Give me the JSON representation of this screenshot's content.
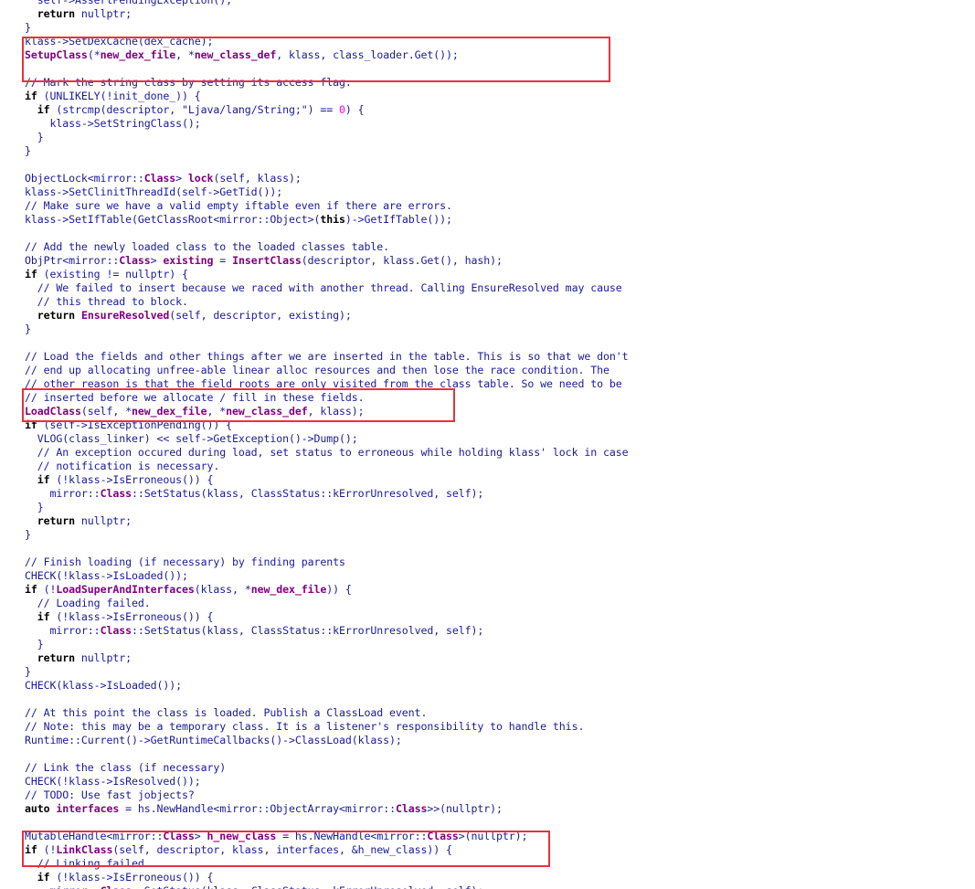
{
  "code_lines": [
    [
      {
        "t": "  self->AssertPendingException();",
        "c": "op"
      }
    ],
    [
      {
        "t": "  ",
        "c": "op"
      },
      {
        "t": "return",
        "c": "kw"
      },
      {
        "t": " nullptr;",
        "c": "op"
      }
    ],
    [
      {
        "t": "}",
        "c": "op"
      }
    ],
    [
      {
        "t": "klass->SetDexCache(dex_cache);",
        "c": "op"
      }
    ],
    [
      {
        "t": "SetupClass",
        "c": "fn"
      },
      {
        "t": "(*",
        "c": "op"
      },
      {
        "t": "new_dex_file",
        "c": "var"
      },
      {
        "t": ", *",
        "c": "op"
      },
      {
        "t": "new_class_def",
        "c": "var"
      },
      {
        "t": ", klass, class_loader.Get());",
        "c": "op"
      }
    ],
    [
      {
        "t": "",
        "c": "op"
      }
    ],
    [
      {
        "t": "// Mark the string class by setting its access flag.",
        "c": "cm"
      }
    ],
    [
      {
        "t": "if",
        "c": "kw"
      },
      {
        "t": " (UNLIKELY(!init_done_)) {",
        "c": "op"
      }
    ],
    [
      {
        "t": "  ",
        "c": "op"
      },
      {
        "t": "if",
        "c": "kw"
      },
      {
        "t": " (strcmp(descriptor, \"Ljava/lang/String;\") == ",
        "c": "op"
      },
      {
        "t": "0",
        "c": "num"
      },
      {
        "t": ") {",
        "c": "op"
      }
    ],
    [
      {
        "t": "    klass->SetStringClass();",
        "c": "op"
      }
    ],
    [
      {
        "t": "  }",
        "c": "op"
      }
    ],
    [
      {
        "t": "}",
        "c": "op"
      }
    ],
    [
      {
        "t": "",
        "c": "op"
      }
    ],
    [
      {
        "t": "ObjectLock<mirror::",
        "c": "op"
      },
      {
        "t": "Class",
        "c": "cls"
      },
      {
        "t": "> ",
        "c": "op"
      },
      {
        "t": "lock",
        "c": "var"
      },
      {
        "t": "(self, klass);",
        "c": "op"
      }
    ],
    [
      {
        "t": "klass->SetClinitThreadId(self->GetTid());",
        "c": "op"
      }
    ],
    [
      {
        "t": "// Make sure we have a valid empty iftable even if there are errors.",
        "c": "cm"
      }
    ],
    [
      {
        "t": "klass->SetIfTable(GetClassRoot<mirror::Object>(",
        "c": "op"
      },
      {
        "t": "this",
        "c": "kw"
      },
      {
        "t": ")->GetIfTable());",
        "c": "op"
      }
    ],
    [
      {
        "t": "",
        "c": "op"
      }
    ],
    [
      {
        "t": "// Add the newly loaded class to the loaded classes table.",
        "c": "cm"
      }
    ],
    [
      {
        "t": "ObjPtr<mirror::",
        "c": "op"
      },
      {
        "t": "Class",
        "c": "cls"
      },
      {
        "t": "> ",
        "c": "op"
      },
      {
        "t": "existing",
        "c": "var"
      },
      {
        "t": " = ",
        "c": "op"
      },
      {
        "t": "InsertClass",
        "c": "fn"
      },
      {
        "t": "(descriptor, klass.Get(), hash);",
        "c": "op"
      }
    ],
    [
      {
        "t": "if",
        "c": "kw"
      },
      {
        "t": " (existing != nullptr) {",
        "c": "op"
      }
    ],
    [
      {
        "t": "  // We failed to insert because we raced with another thread. Calling EnsureResolved may cause",
        "c": "cm"
      }
    ],
    [
      {
        "t": "  // this thread to block.",
        "c": "cm"
      }
    ],
    [
      {
        "t": "  ",
        "c": "op"
      },
      {
        "t": "return",
        "c": "kw"
      },
      {
        "t": " ",
        "c": "op"
      },
      {
        "t": "EnsureResolved",
        "c": "fn"
      },
      {
        "t": "(self, descriptor, existing);",
        "c": "op"
      }
    ],
    [
      {
        "t": "}",
        "c": "op"
      }
    ],
    [
      {
        "t": "",
        "c": "op"
      }
    ],
    [
      {
        "t": "// Load the fields and other things after we are inserted in the table. This is so that we don't",
        "c": "cm"
      }
    ],
    [
      {
        "t": "// end up allocating unfree-able linear alloc resources and then lose the race condition. The",
        "c": "cm"
      }
    ],
    [
      {
        "t": "// other reason is that the field roots are only visited from the class table. So we need to be",
        "c": "cm"
      }
    ],
    [
      {
        "t": "// inserted before we allocate / fill in these fields.",
        "c": "cm"
      }
    ],
    [
      {
        "t": "LoadClass",
        "c": "fn"
      },
      {
        "t": "(self, *",
        "c": "op"
      },
      {
        "t": "new_dex_file",
        "c": "var"
      },
      {
        "t": ", *",
        "c": "op"
      },
      {
        "t": "new_class_def",
        "c": "var"
      },
      {
        "t": ", klass);",
        "c": "op"
      }
    ],
    [
      {
        "t": "if",
        "c": "kw"
      },
      {
        "t": " (self->IsExceptionPending()) {",
        "c": "op"
      }
    ],
    [
      {
        "t": "  VLOG(class_linker) << self->GetException()->Dump();",
        "c": "op"
      }
    ],
    [
      {
        "t": "  // An exception occured during load, set status to erroneous while holding klass' lock in case",
        "c": "cm"
      }
    ],
    [
      {
        "t": "  // notification is necessary.",
        "c": "cm"
      }
    ],
    [
      {
        "t": "  ",
        "c": "op"
      },
      {
        "t": "if",
        "c": "kw"
      },
      {
        "t": " (!klass->IsErroneous()) {",
        "c": "op"
      }
    ],
    [
      {
        "t": "    mirror::",
        "c": "op"
      },
      {
        "t": "Class",
        "c": "cls"
      },
      {
        "t": "::SetStatus(klass, ClassStatus::kErrorUnresolved, self);",
        "c": "op"
      }
    ],
    [
      {
        "t": "  }",
        "c": "op"
      }
    ],
    [
      {
        "t": "  ",
        "c": "op"
      },
      {
        "t": "return",
        "c": "kw"
      },
      {
        "t": " nullptr;",
        "c": "op"
      }
    ],
    [
      {
        "t": "}",
        "c": "op"
      }
    ],
    [
      {
        "t": "",
        "c": "op"
      }
    ],
    [
      {
        "t": "// Finish loading (if necessary) by finding parents",
        "c": "cm"
      }
    ],
    [
      {
        "t": "CHECK(!klass->IsLoaded());",
        "c": "op"
      }
    ],
    [
      {
        "t": "if",
        "c": "kw"
      },
      {
        "t": " (!",
        "c": "op"
      },
      {
        "t": "LoadSuperAndInterfaces",
        "c": "fn"
      },
      {
        "t": "(klass, *",
        "c": "op"
      },
      {
        "t": "new_dex_file",
        "c": "var"
      },
      {
        "t": ")) {",
        "c": "op"
      }
    ],
    [
      {
        "t": "  // Loading failed.",
        "c": "cm"
      }
    ],
    [
      {
        "t": "  ",
        "c": "op"
      },
      {
        "t": "if",
        "c": "kw"
      },
      {
        "t": " (!klass->IsErroneous()) {",
        "c": "op"
      }
    ],
    [
      {
        "t": "    mirror::",
        "c": "op"
      },
      {
        "t": "Class",
        "c": "cls"
      },
      {
        "t": "::SetStatus(klass, ClassStatus::kErrorUnresolved, self);",
        "c": "op"
      }
    ],
    [
      {
        "t": "  }",
        "c": "op"
      }
    ],
    [
      {
        "t": "  ",
        "c": "op"
      },
      {
        "t": "return",
        "c": "kw"
      },
      {
        "t": " nullptr;",
        "c": "op"
      }
    ],
    [
      {
        "t": "}",
        "c": "op"
      }
    ],
    [
      {
        "t": "CHECK(klass->IsLoaded());",
        "c": "op"
      }
    ],
    [
      {
        "t": "",
        "c": "op"
      }
    ],
    [
      {
        "t": "// At this point the class is loaded. Publish a ClassLoad event.",
        "c": "cm"
      }
    ],
    [
      {
        "t": "// Note: this may be a temporary class. It is a listener's responsibility to handle this.",
        "c": "cm"
      }
    ],
    [
      {
        "t": "Runtime::Current()->GetRuntimeCallbacks()->ClassLoad(klass);",
        "c": "op"
      }
    ],
    [
      {
        "t": "",
        "c": "op"
      }
    ],
    [
      {
        "t": "// Link the class (if necessary)",
        "c": "cm"
      }
    ],
    [
      {
        "t": "CHECK(!klass->IsResolved());",
        "c": "op"
      }
    ],
    [
      {
        "t": "// TODO: Use fast jobjects?",
        "c": "cm"
      }
    ],
    [
      {
        "t": "auto",
        "c": "kw"
      },
      {
        "t": " ",
        "c": "op"
      },
      {
        "t": "interfaces",
        "c": "var"
      },
      {
        "t": " = hs.NewHandle<mirror::ObjectArray<mirror::",
        "c": "op"
      },
      {
        "t": "Class",
        "c": "cls"
      },
      {
        "t": ">>(nullptr);",
        "c": "op"
      }
    ],
    [
      {
        "t": "",
        "c": "op"
      }
    ],
    [
      {
        "t": "MutableHandle<mirror::",
        "c": "op"
      },
      {
        "t": "Class",
        "c": "cls"
      },
      {
        "t": "> ",
        "c": "op"
      },
      {
        "t": "h_new_class",
        "c": "var"
      },
      {
        "t": " = hs.NewHandle<mirror::",
        "c": "op"
      },
      {
        "t": "Class",
        "c": "cls"
      },
      {
        "t": ">(nullptr);",
        "c": "op"
      }
    ],
    [
      {
        "t": "if",
        "c": "kw"
      },
      {
        "t": " (!",
        "c": "op"
      },
      {
        "t": "LinkClass",
        "c": "fn"
      },
      {
        "t": "(self, descriptor, klass, interfaces, &h_new_class)) {",
        "c": "op"
      }
    ],
    [
      {
        "t": "  // Linking failed.",
        "c": "cm"
      }
    ],
    [
      {
        "t": "  ",
        "c": "op"
      },
      {
        "t": "if",
        "c": "kw"
      },
      {
        "t": " (!klass->IsErroneous()) {",
        "c": "op"
      }
    ],
    [
      {
        "t": "    mirror::",
        "c": "op"
      },
      {
        "t": "Class",
        "c": "cls"
      },
      {
        "t": "::SetStatus(klass, ClassStatus::kErrorUnresolved, self);",
        "c": "op"
      }
    ]
  ],
  "highlight_color": "#e8323c",
  "highlights": [
    {
      "name": "setup-class-highlight",
      "from_line": 3,
      "to_line": 4
    },
    {
      "name": "load-class-highlight",
      "from_line": 29,
      "to_line": 30
    },
    {
      "name": "link-class-highlight",
      "from_line": 61,
      "to_line": 62
    }
  ]
}
